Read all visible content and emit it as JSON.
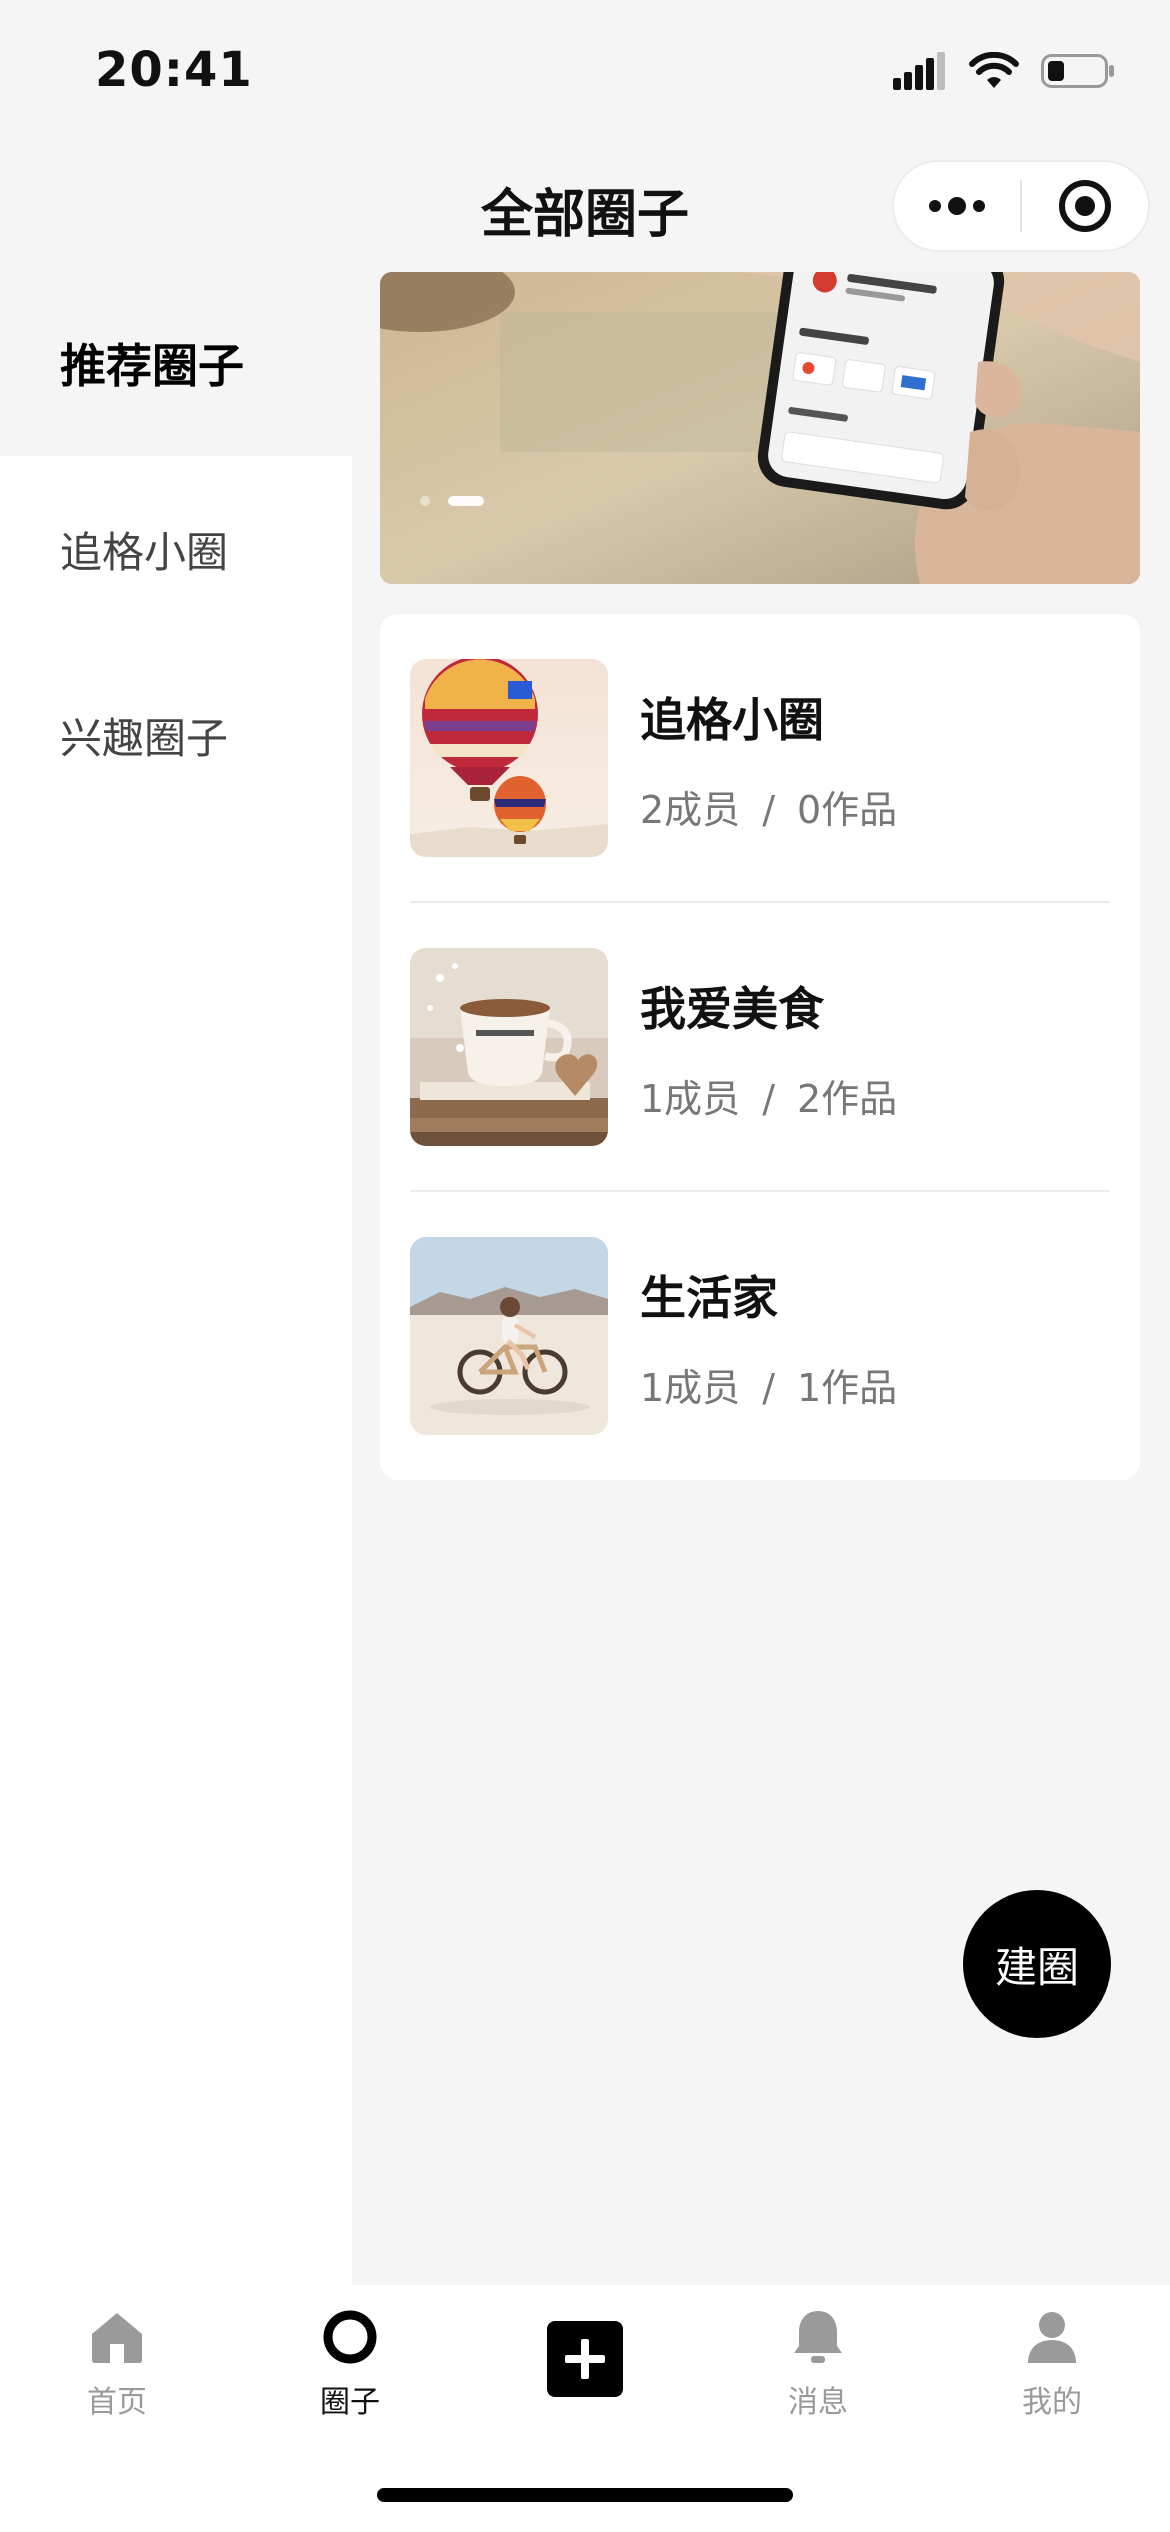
{
  "status_bar": {
    "time": "20:41",
    "icons": [
      "cellular-signal-icon",
      "wifi-icon",
      "battery-icon"
    ]
  },
  "header": {
    "title": "全部圈子",
    "capsule": {
      "more_icon": "more-dots-icon",
      "close_icon": "target-close-icon"
    }
  },
  "sidebar": {
    "items": [
      {
        "label": "推荐圈子",
        "active": true
      },
      {
        "label": "追格小圈",
        "active": false
      },
      {
        "label": "兴趣圈子",
        "active": false
      }
    ]
  },
  "banner": {
    "slide_count": 2,
    "active_index": 1
  },
  "circles": [
    {
      "name": "追格小圈",
      "members": "2成员",
      "separator": "/",
      "works": "0作品",
      "thumb": "hot-air-balloons"
    },
    {
      "name": "我爱美食",
      "members": "1成员",
      "separator": "/",
      "works": "2作品",
      "thumb": "coffee-cup-books"
    },
    {
      "name": "生活家",
      "members": "1成员",
      "separator": "/",
      "works": "1作品",
      "thumb": "child-on-bike-desert"
    }
  ],
  "fab": {
    "label": "建圈"
  },
  "tab_bar": {
    "items": [
      {
        "label": "首页",
        "icon": "home-icon",
        "active": false
      },
      {
        "label": "圈子",
        "icon": "circle-icon",
        "active": true
      },
      {
        "label": "",
        "icon": "plus-icon",
        "active": false
      },
      {
        "label": "消息",
        "icon": "bell-icon",
        "active": false
      },
      {
        "label": "我的",
        "icon": "user-icon",
        "active": false
      }
    ]
  },
  "colors": {
    "background": "#f5f5f5",
    "card": "#ffffff",
    "accent": "#000000",
    "muted_text": "#777777",
    "tab_inactive": "#9a9a9a"
  }
}
